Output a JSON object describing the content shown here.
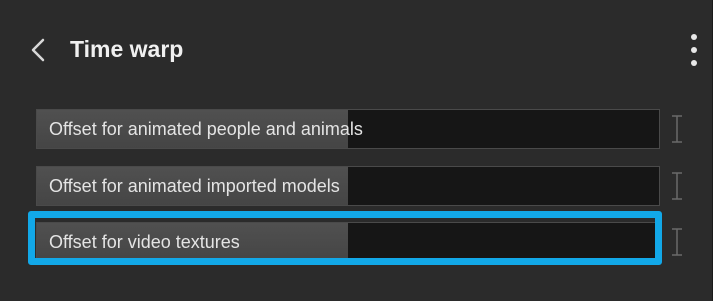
{
  "header": {
    "title": "Time warp",
    "back_icon": "chevron-left-icon",
    "more_icon": "more-vertical-icon"
  },
  "sliders": [
    {
      "label": "Offset for animated people and animals",
      "value_fraction": 0.5
    },
    {
      "label": "Offset for animated imported models",
      "value_fraction": 0.5
    },
    {
      "label": "Offset for video textures",
      "value_fraction": 0.5
    }
  ],
  "reset_icon": "i-beam-icon",
  "highlighted_item": "Offset for video textures",
  "colors": {
    "panel_background": "#2b2b2b",
    "slider_track": "#161616",
    "slider_fill": "#4d4d4d",
    "highlight_border": "#12a8e8",
    "text": "#e4e4e4"
  }
}
